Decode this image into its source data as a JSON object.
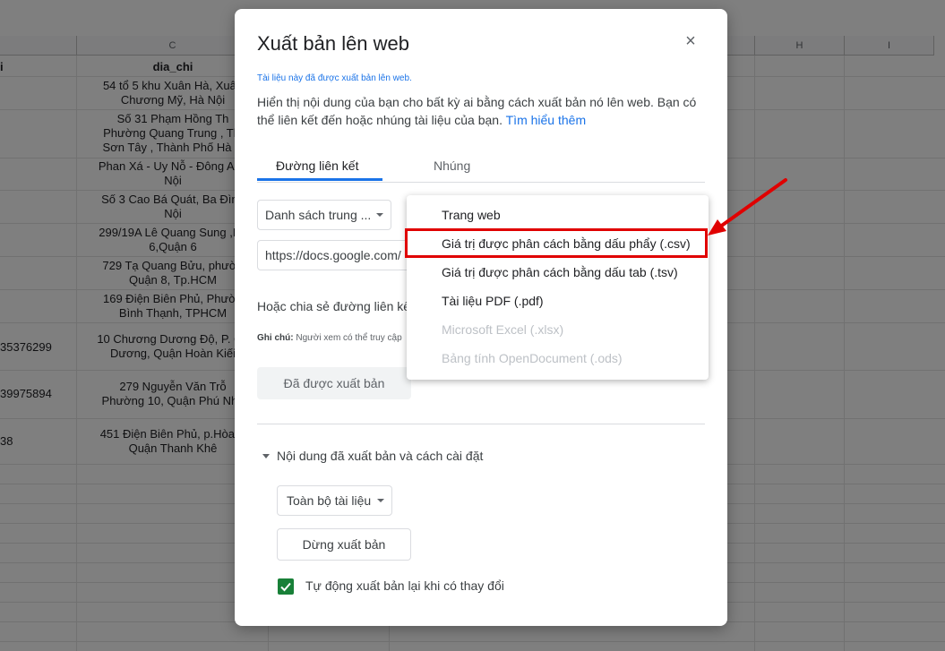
{
  "sheet": {
    "columns": [
      "C",
      "H",
      "I"
    ],
    "header_cells": [
      "i",
      "dia_chi"
    ],
    "rows": [
      {
        "left": "",
        "address": "54 tổ 5 khu Xuân Hà, Xuân\nChương Mỹ, Hà Nội"
      },
      {
        "left": "",
        "address": "Số 31 Phạm Hồng Th\nPhường Quang Trung , Thị\nSơn Tây , Thành Phố Hà N"
      },
      {
        "left": "",
        "address": "Phan Xá - Uy Nỗ - Đông Anh\nNội"
      },
      {
        "left": "",
        "address": "Số 3 Cao Bá Quát, Ba Đình\nNội"
      },
      {
        "left": "",
        "address": "299/19A Lê Quang Sung ,Ph\n6,Quận 6"
      },
      {
        "left": "",
        "address": "729 Tạ Quang Bửu, phườn\nQuận 8, Tp.HCM"
      },
      {
        "left": "",
        "address": "169 Điện Biên Phủ, Phườn\nBình Thạnh, TPHCM"
      },
      {
        "left": "35376299",
        "address": "10 Chương Dương Độ, P. Ch\nDương, Quận Hoàn Kiếi"
      },
      {
        "left": "39975894",
        "address": "279 Nguyễn Văn Trỗ\nPhường 10, Quận Phú Nhu"
      },
      {
        "left": "38",
        "address": "451 Điện Biên Phủ, p.Hòa K\nQuận Thanh Khê"
      }
    ]
  },
  "dialog": {
    "title": "Xuất bản lên web",
    "close_symbol": "×",
    "published_note": "Tài liệu này đã được xuất bản lên web.",
    "description": "Hiển thị nội dung của bạn cho bất kỳ ai bằng cách xuất bản nó lên web. Bạn có thể liên kết đến hoặc nhúng tài liệu của bạn.",
    "learn_more": "Tìm hiểu thêm",
    "tabs": [
      "Đường liên kết",
      "Nhúng"
    ],
    "sheet_select": "Danh sách trung ...",
    "url": "https://docs.google.com/",
    "share_text": "Hoặc chia sẻ đường liên kế",
    "note_label": "Ghi chú:",
    "note_text": "Người xem có thể truy cập",
    "published_button": "Đã được xuất bản",
    "settings_toggle": "Nội dung đã xuất bản và cách cài đặt",
    "scope_select": "Toàn bộ tài liệu",
    "stop_button": "Dừng xuất bản",
    "auto_republish_label": "Tự động xuất bản lại khi có thay đổi",
    "auto_republish_checked": true
  },
  "format_menu": {
    "items": [
      {
        "label": "Trang web",
        "enabled": true
      },
      {
        "label": "Giá trị được phân cách bằng dấu phẩy (.csv)",
        "enabled": true,
        "highlighted": true
      },
      {
        "label": "Giá trị được phân cách bằng dấu tab (.tsv)",
        "enabled": true
      },
      {
        "label": "Tài liệu PDF (.pdf)",
        "enabled": true
      },
      {
        "label": "Microsoft Excel (.xlsx)",
        "enabled": false
      },
      {
        "label": "Bảng tính OpenDocument (.ods)",
        "enabled": false
      }
    ]
  },
  "colors": {
    "accent": "#1a73e8",
    "annotation": "#e00000",
    "checkbox": "#188038"
  }
}
